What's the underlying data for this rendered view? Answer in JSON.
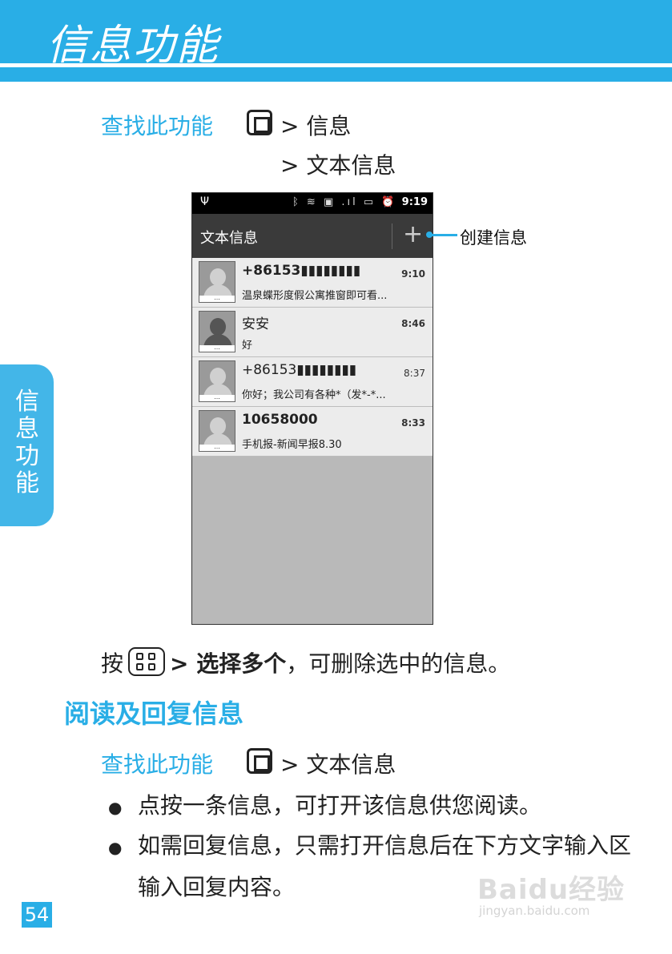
{
  "header": {
    "title": "信息功能"
  },
  "side_tab": {
    "text": "信息功能"
  },
  "find_feature": {
    "label": "查找此功能",
    "path_messages": "> 信息",
    "path_text_messages": "> 文本信息"
  },
  "phone": {
    "status_bar": {
      "time": "9:19",
      "usb_icon": "usb-icon",
      "icons": "bluetooth-icon vibrate-icon edge-icon signal-icon battery-icon alarm-icon"
    },
    "app_bar": {
      "title": "文本信息",
      "add_symbol": "+"
    },
    "threads": [
      {
        "name": "+86153▮▮▮▮▮▮▮▮",
        "time": "9:10",
        "preview": "温泉蝶形度假公寓推窗即可看...",
        "unread": true
      },
      {
        "name": "安安",
        "time": "8:46",
        "preview": "好",
        "unread": false
      },
      {
        "name": "+86153▮▮▮▮▮▮▮▮",
        "time": "8:37",
        "preview": "你好；我公司有各种*（发*-*...",
        "unread": false
      },
      {
        "name": "10658000",
        "time": "8:33",
        "preview": "手机报-新闻早报8.30",
        "unread": true
      }
    ]
  },
  "callout": {
    "create_message": "创建信息"
  },
  "instruction": {
    "press": "按",
    "select_multiple": "> 选择多个",
    "rest": "，可删除选中的信息。"
  },
  "section": {
    "title": "阅读及回复信息",
    "find_label": "查找此功能",
    "path": "> 文本信息",
    "bullets": [
      "点按一条信息，可打开该信息供您阅读。",
      "如需回复信息，只需打开信息后在下方文字输入区输入回复内容。"
    ]
  },
  "page_number": "54",
  "watermark": {
    "brand": "Baidu经验",
    "url": "jingyan.baidu.com"
  },
  "colors": {
    "accent": "#29aee6"
  }
}
